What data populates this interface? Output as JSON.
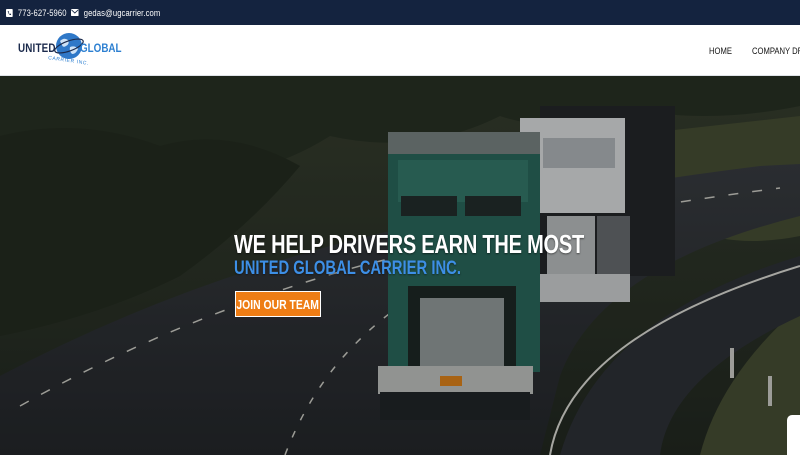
{
  "topbar": {
    "phone": "773-627-5960",
    "email": "gedas@ugcarrier.com"
  },
  "logo": {
    "word1": "UNITED",
    "word2": "GLOBAL",
    "tagline": "CARRIER INC."
  },
  "nav": {
    "items": [
      "HOME",
      "COMPANY DRI"
    ]
  },
  "hero": {
    "title": "WE HELP DRIVERS EARN THE MOST",
    "subtitle": "UNITED GLOBAL CARRIER INC.",
    "cta": "JOIN OUR TEAM"
  },
  "colors": {
    "topbar": "#14233f",
    "accent_blue": "#3d8fe6",
    "cta_orange": "#ee7d15"
  }
}
